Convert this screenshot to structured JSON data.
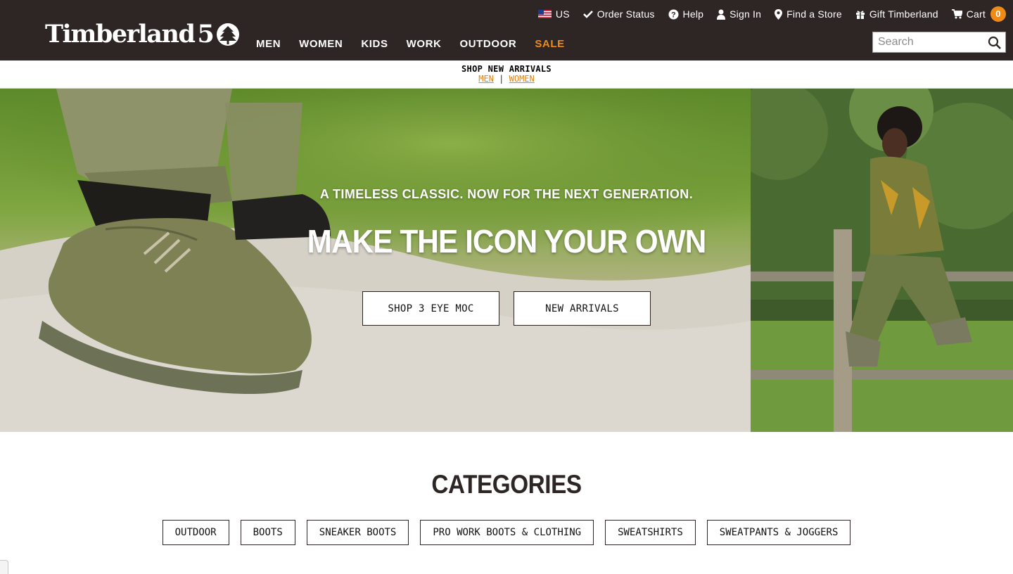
{
  "header": {
    "logo": {
      "word": "Timberland",
      "anniversary": "5"
    },
    "utility": [
      {
        "name": "country-selector",
        "icon": "us-flag-icon",
        "label": "US"
      },
      {
        "name": "order-status-link",
        "icon": "checkmark-icon",
        "label": "Order Status"
      },
      {
        "name": "help-link",
        "icon": "question-circle-icon",
        "label": "Help"
      },
      {
        "name": "sign-in-link",
        "icon": "user-icon",
        "label": "Sign In"
      },
      {
        "name": "find-store-link",
        "icon": "map-pin-icon",
        "label": "Find a Store"
      },
      {
        "name": "gift-link",
        "icon": "gift-icon",
        "label": "Gift Timberland"
      },
      {
        "name": "cart-link",
        "icon": "cart-icon",
        "label": "Cart",
        "count": "0"
      }
    ],
    "nav": [
      "MEN",
      "WOMEN",
      "KIDS",
      "WORK",
      "OUTDOOR",
      "SALE"
    ],
    "search": {
      "placeholder": "Search"
    }
  },
  "promo": {
    "title": "SHOP NEW ARRIVALS",
    "link_men": "MEN",
    "separator": "|",
    "link_women": "WOMEN"
  },
  "hero": {
    "eyebrow": "A TIMELESS CLASSIC. NOW FOR THE NEXT GENERATION.",
    "headline": "MAKE THE ICON YOUR OWN",
    "primary_cta": "SHOP 3 EYE MOC",
    "secondary_cta": "NEW ARRIVALS"
  },
  "categories": {
    "title": "CATEGORIES",
    "items": [
      "OUTDOOR",
      "BOOTS",
      "SNEAKER BOOTS",
      "PRO WORK BOOTS & CLOTHING",
      "SWEATSHIRTS",
      "SWEATPANTS & JOGGERS"
    ]
  },
  "colors": {
    "header_bg": "#2e2624",
    "accent_orange": "#f08a17",
    "text_dark": "#2e2624"
  }
}
